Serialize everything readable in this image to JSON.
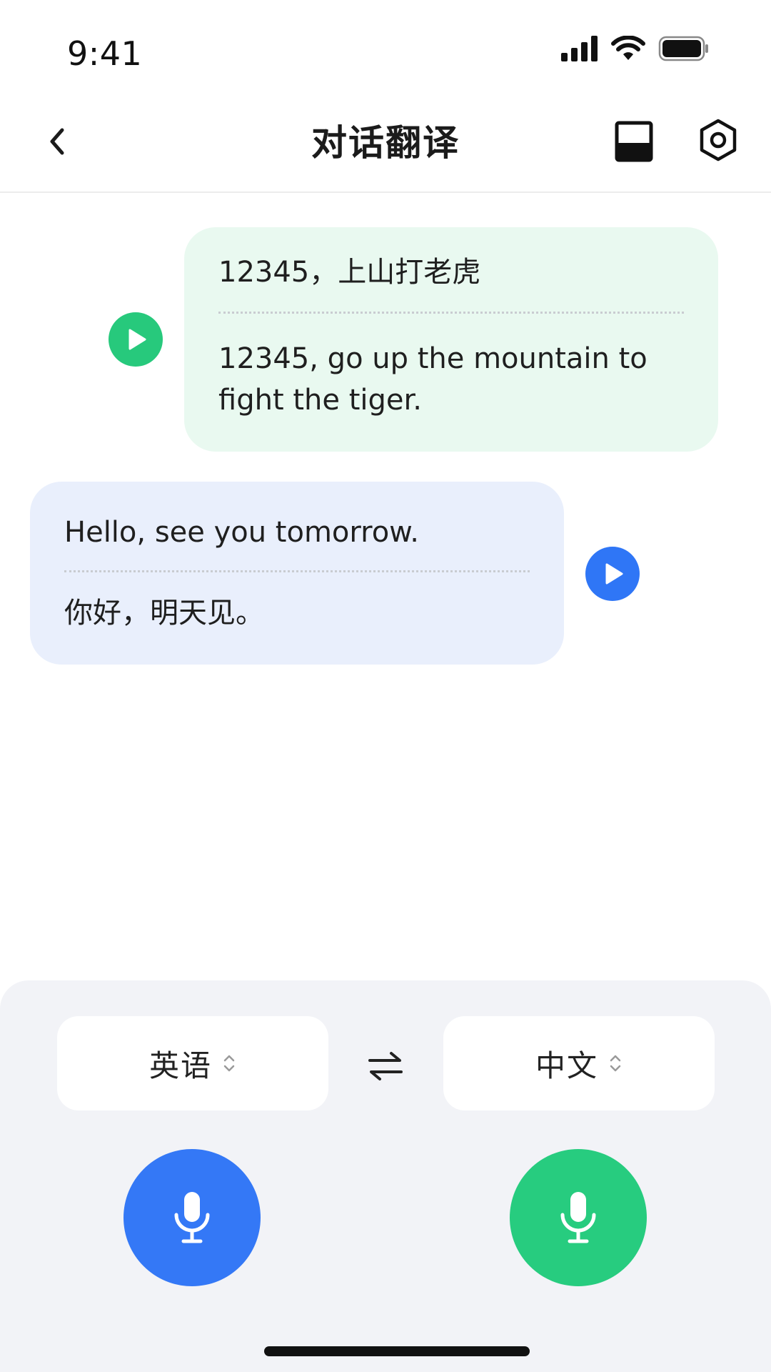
{
  "status_bar": {
    "time": "9:41",
    "icons": [
      "signal-icon",
      "wifi-icon",
      "battery-icon"
    ]
  },
  "header": {
    "title": "对话翻译",
    "back_icon": "chevron-left-icon",
    "layout_icon": "split-layout-icon",
    "settings_icon": "settings-hex-icon"
  },
  "messages": [
    {
      "side": "right",
      "original": "12345，上山打老虎",
      "translation_line1": "12345, go up the mountain to",
      "translation_line2": "fight the tiger.",
      "bubble_color": "#e9f9f0",
      "play_color": "#27c97c"
    },
    {
      "side": "left",
      "original": "Hello, see you tomorrow.",
      "translation": "你好，明天见。",
      "bubble_color": "#e9effc",
      "play_color": "#2f76f6"
    }
  ],
  "languages": {
    "left": "英语",
    "right": "中文",
    "swap_icon": "swap-arrows-icon"
  },
  "mics": {
    "left_color": "#3478f6",
    "right_color": "#27cc7f"
  }
}
